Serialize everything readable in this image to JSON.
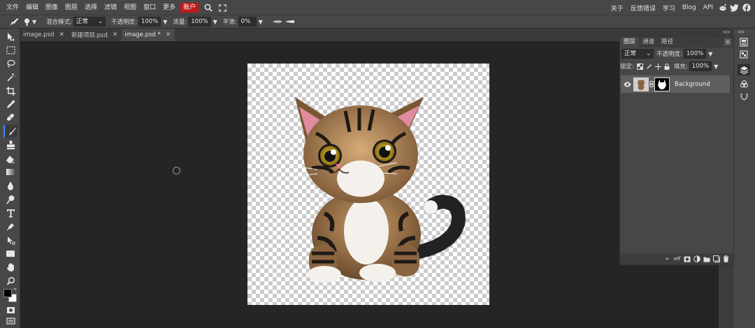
{
  "colors": {
    "accent": "#3a86ff",
    "account_bg": "#c0191a",
    "chrome": "#474747",
    "workspace": "#252525"
  },
  "menu": {
    "items": [
      "文件",
      "编辑",
      "图像",
      "图层",
      "选择",
      "滤镜",
      "视图",
      "窗口",
      "更多"
    ],
    "account": "账户",
    "icons": [
      "search-icon",
      "fullscreen-icon"
    ],
    "right_items": [
      "关于",
      "反馈错误",
      "学习",
      "Blog",
      "API"
    ],
    "social_icons": [
      "reddit-icon",
      "twitter-icon",
      "facebook-icon"
    ]
  },
  "options": {
    "blend_mode_label": "混合模式:",
    "blend_mode_value": "正常",
    "opacity_label": "不透明度:",
    "opacity_value": "100%",
    "flow_label": "流量:",
    "flow_value": "100%",
    "smoothing_label": "平滑:",
    "smoothing_value": "0%"
  },
  "tools": [
    "move-tool-icon",
    "marquee-tool-icon",
    "lasso-tool-icon",
    "magic-wand-icon",
    "crop-tool-icon",
    "eyedropper-icon",
    "healing-brush-icon",
    "brush-tool-icon",
    "clone-stamp-icon",
    "eraser-icon",
    "gradient-tool-icon",
    "blur-tool-icon",
    "dodge-tool-icon",
    "type-tool-icon",
    "pen-tool-icon",
    "path-select-icon",
    "shape-tool-icon",
    "hand-tool-icon",
    "zoom-tool-icon"
  ],
  "active_tool": "brush-tool-icon",
  "doc_tabs": [
    {
      "label": "image.psd",
      "active": false
    },
    {
      "label": "新建项目.psd",
      "active": false
    },
    {
      "label": "image.psd *",
      "active": true
    }
  ],
  "layers_panel": {
    "tabs": [
      "图层",
      "通道",
      "路径"
    ],
    "blend_mode": "正常",
    "opacity_label": "不透明度:",
    "opacity_value": "100%",
    "lock_label": "锁定:",
    "fill_label": "填充:",
    "fill_value": "100%",
    "layer_name": "Background",
    "footer_icons": [
      "link-icon",
      "effects-icon",
      "mask-icon",
      "adjustment-icon",
      "folder-icon",
      "new-layer-icon",
      "trash-icon"
    ]
  },
  "side_panel_icons": [
    "history-icon",
    "swatches-icon",
    "layers-icon",
    "channels-icon",
    "paths-icon"
  ]
}
